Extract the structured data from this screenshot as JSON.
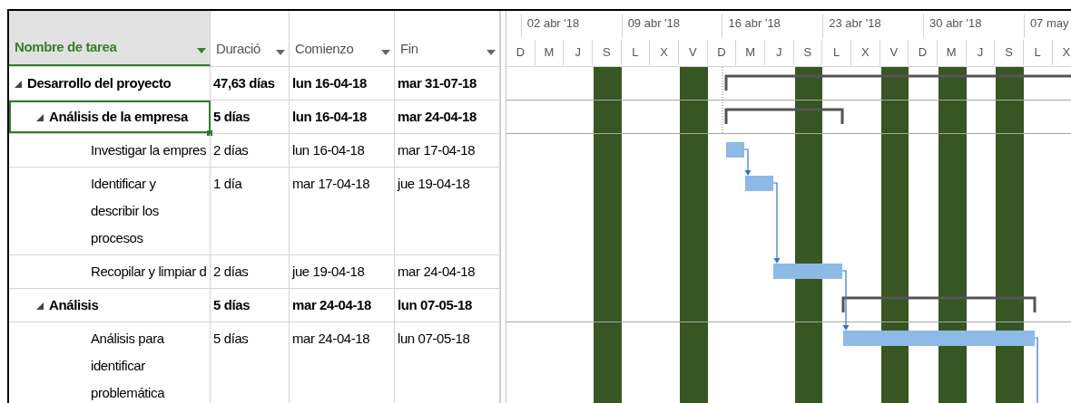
{
  "columns": [
    {
      "label": "Nombre de tarea",
      "selected": true
    },
    {
      "label": "Duració",
      "selected": false
    },
    {
      "label": "Comienzo",
      "selected": false
    },
    {
      "label": "Fin",
      "selected": false
    }
  ],
  "timescale": {
    "weeks": [
      "02 abr '18",
      "09 abr '18",
      "16 abr '18",
      "23 abr '18",
      "30 abr '18",
      "07 may"
    ],
    "units": [
      {
        "label": "D",
        "shaded": false
      },
      {
        "label": "M",
        "shaded": false
      },
      {
        "label": "J",
        "shaded": false
      },
      {
        "label": "S",
        "shaded": true
      },
      {
        "label": "L",
        "shaded": false
      },
      {
        "label": "X",
        "shaded": false
      },
      {
        "label": "V",
        "shaded": true
      },
      {
        "label": "D",
        "shaded": false
      },
      {
        "label": "M",
        "shaded": false
      },
      {
        "label": "J",
        "shaded": false
      },
      {
        "label": "S",
        "shaded": true
      },
      {
        "label": "L",
        "shaded": false
      },
      {
        "label": "X",
        "shaded": false
      },
      {
        "label": "V",
        "shaded": true
      },
      {
        "label": "D",
        "shaded": false
      },
      {
        "label": "M",
        "shaded": true
      },
      {
        "label": "J",
        "shaded": false
      },
      {
        "label": "S",
        "shaded": true
      },
      {
        "label": "L",
        "shaded": false
      },
      {
        "label": "X",
        "shaded": false
      }
    ]
  },
  "tasks": [
    {
      "name": "Desarrollo del proyecto",
      "duration": "47,63 días",
      "start": "lun 16-04-18",
      "finish": "mar 31-07-18",
      "expanded": true,
      "selected": false,
      "children": [
        {
          "name": "Análisis de la empresa",
          "duration": "5 días",
          "start": "lun 16-04-18",
          "finish": "mar 24-04-18",
          "expanded": true,
          "selected": true,
          "children": [
            {
              "name": "Investigar la empres",
              "duration": "2 días",
              "start": "lun 16-04-18",
              "finish": "mar 17-04-18",
              "selected": false,
              "wrapped": false
            },
            {
              "name": "Identificar y describir los procesos",
              "duration": "1 día",
              "start": "mar 17-04-18",
              "finish": "jue 19-04-18",
              "selected": false,
              "wrapped": true
            },
            {
              "name": "Recopilar y limpiar d",
              "duration": "2 días",
              "start": "jue 19-04-18",
              "finish": "mar 24-04-18",
              "selected": false,
              "wrapped": false
            }
          ]
        },
        {
          "name": "Análisis",
          "duration": "5 días",
          "start": "mar 24-04-18",
          "finish": "lun 07-05-18",
          "expanded": true,
          "selected": false,
          "children": [
            {
              "name": "Análisis para identificar problemática",
              "duration": "5 días",
              "start": "mar 24-04-18",
              "finish": "lun 07-05-18",
              "selected": false,
              "wrapped": true
            }
          ]
        }
      ]
    }
  ]
}
